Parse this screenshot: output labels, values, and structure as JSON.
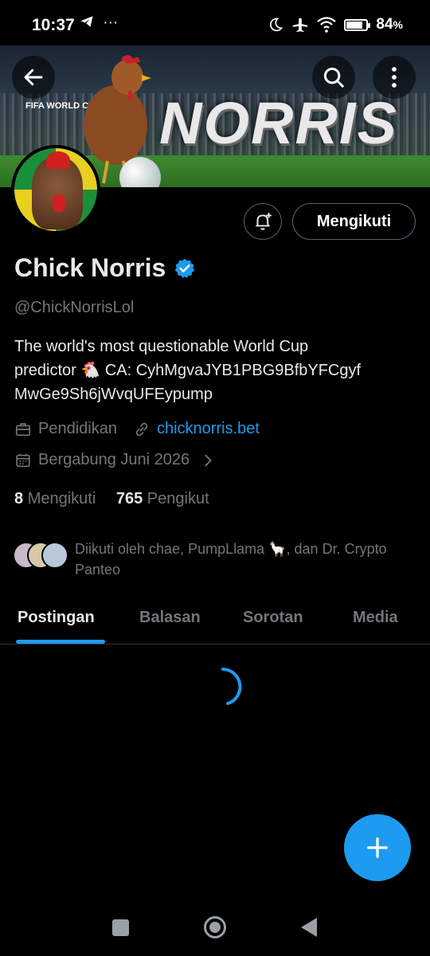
{
  "status_bar": {
    "time": "10:37",
    "left_icons": [
      "telegram-icon",
      "more-dots-icon"
    ],
    "battery_percent": "84",
    "battery_symbol": "%",
    "battery_level": 0.84,
    "right_icons": [
      "moon-icon",
      "airplane-icon",
      "wifi-icon",
      "battery-icon"
    ]
  },
  "header": {
    "banner_wordmark": "NORRIS",
    "banner_logo_text": "FIFA WORLD CUP 2026"
  },
  "profile": {
    "display_name": "Chick Norris",
    "handle": "@ChickNorrisLol",
    "bio_line1": "The world's most questionable World Cup",
    "bio_line2": "predictor 🐔  CA: CyhMgvaJYB1PBG9BfbYFCgyf",
    "bio_line3": "MwGe9Sh6jWvqUFEypump",
    "category": "Pendidikan",
    "website": "chicknorris.bet",
    "joined": "Bergabung Juni 2026",
    "following_count": "8",
    "following_label": "Mengikuti",
    "followers_count": "765",
    "followers_label": "Pengikut",
    "followed_by": "Diikuti oleh chae, PumpLlama 🦙, dan Dr. Crypto Panteo",
    "follow_button": "Mengikuti"
  },
  "tabs": [
    {
      "label": "Postingan",
      "active": true
    },
    {
      "label": "Balasan",
      "active": false
    },
    {
      "label": "Sorotan",
      "active": false
    },
    {
      "label": "Media",
      "active": false
    }
  ],
  "colors": {
    "accent": "#1d9bf0",
    "background": "#000000",
    "secondary_text": "#71767b"
  }
}
